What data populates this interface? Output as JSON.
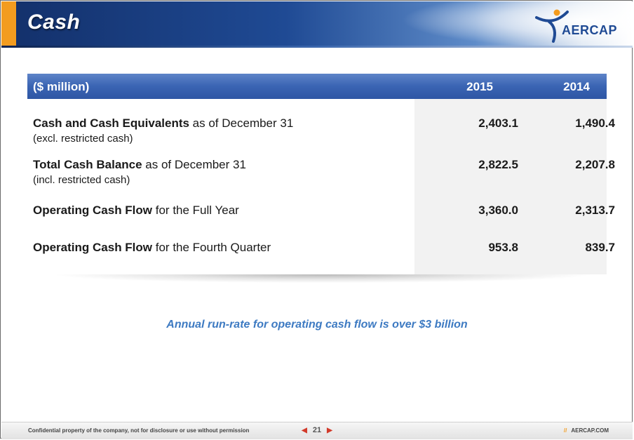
{
  "slide": {
    "title": "Cash",
    "logo_text": "AERCAP",
    "accent_color": "#f39c1f",
    "brand_color": "#1f4a94",
    "note_color": "#3d7ac2"
  },
  "table": {
    "header": {
      "label": "($ million)",
      "col_2015": "2015",
      "col_2014": "2014"
    },
    "rows": [
      {
        "bold": "Cash and Cash Equivalents",
        "rest": " as of December 31",
        "sub": "(excl. restricted cash)",
        "v2015": "2,403.1",
        "v2014": "1,490.4"
      },
      {
        "bold": "Total Cash Balance",
        "rest": " as of December 31",
        "sub": "(incl. restricted cash)",
        "v2015": "2,822.5",
        "v2014": "2,207.8"
      },
      {
        "bold": "Operating Cash Flow",
        "rest": " for the Full Year",
        "sub": "",
        "v2015": "3,360.0",
        "v2014": "2,313.7"
      },
      {
        "bold": "Operating Cash Flow",
        "rest": " for the Fourth Quarter",
        "sub": "",
        "v2015": "953.8",
        "v2014": "839.7"
      }
    ]
  },
  "note": "Annual run-rate for operating cash flow is over $3 billion",
  "footer": {
    "confidential": "Confidential property of the company, not for disclosure or use without permission",
    "page": "21",
    "site": "AERCAP.COM"
  }
}
